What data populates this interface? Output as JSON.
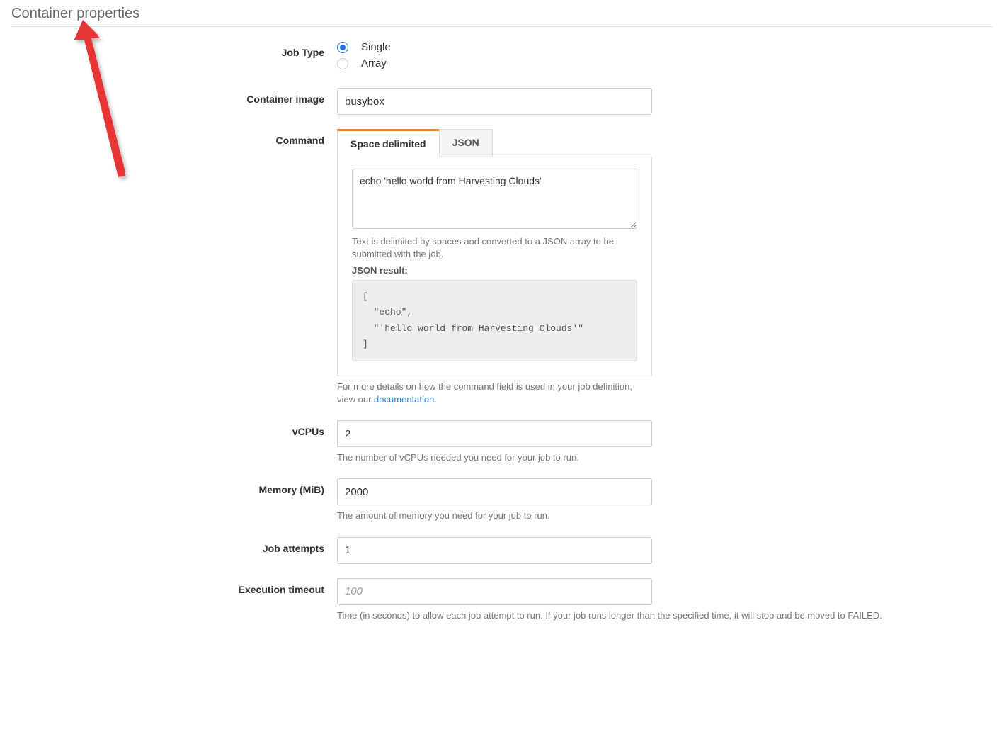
{
  "section": {
    "title": "Container properties"
  },
  "jobType": {
    "label": "Job Type",
    "options": {
      "single": "Single",
      "array": "Array"
    }
  },
  "containerImage": {
    "label": "Container image",
    "value": "busybox"
  },
  "command": {
    "label": "Command",
    "tabs": {
      "space": "Space delimited",
      "json": "JSON"
    },
    "textValue": "echo 'hello world from Harvesting Clouds'",
    "helpText": "Text is delimited by spaces and converted to a JSON array to be submitted with the job.",
    "jsonResultLabel": "JSON result:",
    "jsonResultText": "[\n  \"echo\",\n  \"'hello world from Harvesting Clouds'\"\n]",
    "footerTextPrefix": "For more details on how the command field is used in your job definition, view our ",
    "footerLink": "documentation",
    "footerTextSuffix": "."
  },
  "vcpus": {
    "label": "vCPUs",
    "value": "2",
    "help": "The number of vCPUs needed you need for your job to run."
  },
  "memory": {
    "label": "Memory (MiB)",
    "value": "2000",
    "help": "The amount of memory you need for your job to run."
  },
  "jobAttempts": {
    "label": "Job attempts",
    "value": "1"
  },
  "executionTimeout": {
    "label": "Execution timeout",
    "placeholder": "100",
    "help": "Time (in seconds) to allow each job attempt to run. If your job runs longer than the specified time, it will stop and be moved to FAILED."
  }
}
